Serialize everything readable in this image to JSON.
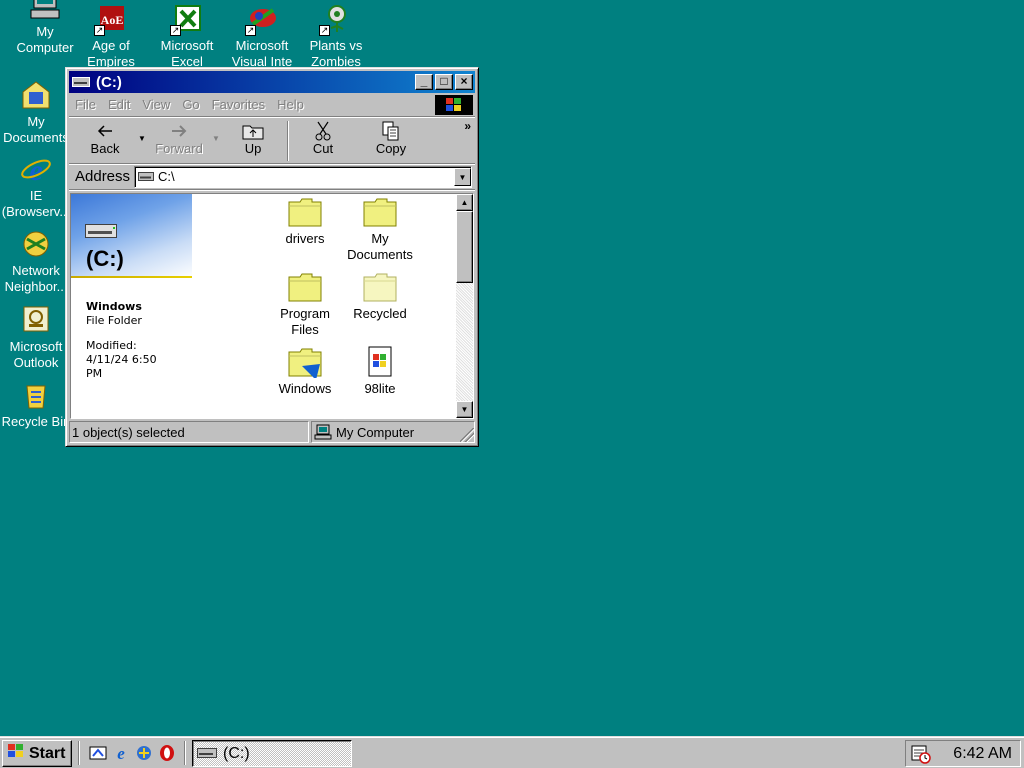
{
  "desktop": {
    "icons": [
      {
        "label": "My Computer"
      },
      {
        "label": "Age of Empires"
      },
      {
        "label": "Microsoft Excel"
      },
      {
        "label": "Microsoft Visual Inte"
      },
      {
        "label": "Plants vs Zombies"
      },
      {
        "label": "My Documents"
      },
      {
        "label": "IE (Browserv..."
      },
      {
        "label": "Network Neighbor..."
      },
      {
        "label": "Microsoft Outlook"
      },
      {
        "label": "Recycle Bin"
      }
    ]
  },
  "window": {
    "title": "(C:)",
    "menu": [
      "File",
      "Edit",
      "View",
      "Go",
      "Favorites",
      "Help"
    ],
    "toolbar": {
      "back": "Back",
      "forward": "Forward",
      "up": "Up",
      "cut": "Cut",
      "copy": "Copy",
      "more": "»"
    },
    "address": {
      "label": "Address",
      "value": "C:\\"
    },
    "webview": {
      "drive_title": "(C:)",
      "selected_name": "Windows",
      "selected_type": "File Folder",
      "modified_label": "Modified:",
      "modified_value": "4/11/24 6:50 PM"
    },
    "files": [
      {
        "name": "drivers",
        "icon": "folder-icon"
      },
      {
        "name": "My Documents",
        "icon": "folder-icon"
      },
      {
        "name": "Program Files",
        "icon": "folder-icon"
      },
      {
        "name": "Recycled",
        "icon": "folder-icon"
      },
      {
        "name": "Windows",
        "icon": "folder-icon"
      },
      {
        "name": "98lite",
        "icon": "setup-file-icon"
      }
    ],
    "status": {
      "selection": "1 object(s) selected",
      "zone": "My Computer"
    }
  },
  "taskbar": {
    "start_label": "Start",
    "task_label": "(C:)",
    "clock": "6:42 AM"
  },
  "colors": {
    "desktop": "#008080",
    "titlebar_start": "#000080",
    "titlebar_end": "#1084d0",
    "face": "#c0c0c0"
  }
}
